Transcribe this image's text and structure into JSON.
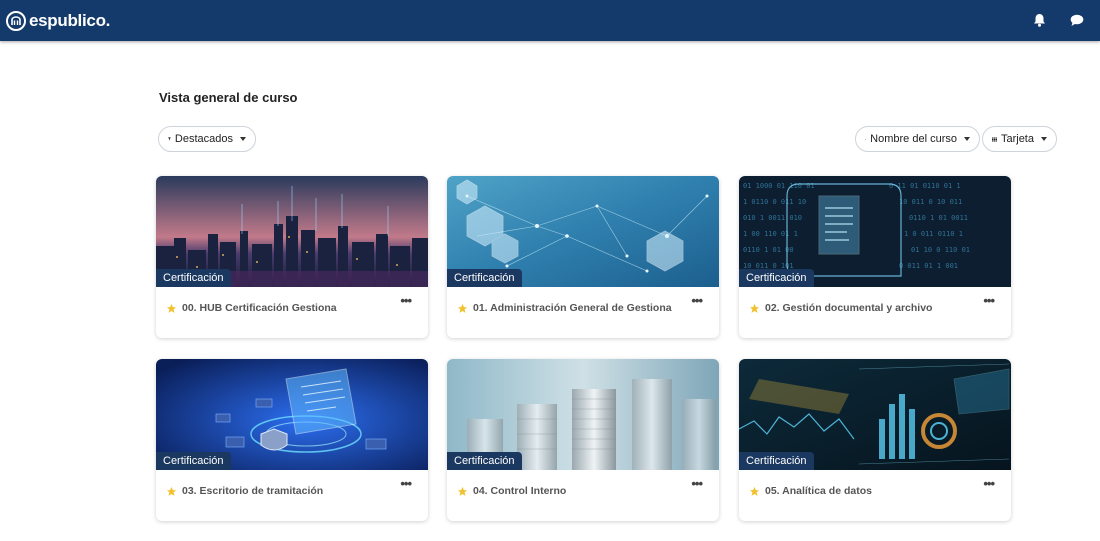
{
  "header": {
    "brand": "espublico.",
    "logo_icon": "espublico-logo-icon",
    "bell_icon": "bell-icon",
    "chat_icon": "chat-icon",
    "bg_color": "#143a6b"
  },
  "page": {
    "title": "Vista general de curso"
  },
  "toolbar": {
    "filter_label": "Destacados",
    "sort_label": "Nombre del curso",
    "view_label": "Tarjeta"
  },
  "courses": [
    {
      "category": "Certificación",
      "name": "00. HUB Certificación Gestiona"
    },
    {
      "category": "Certificación",
      "name": "01. Administración General de Gestiona"
    },
    {
      "category": "Certificación",
      "name": "02. Gestión documental y archivo"
    },
    {
      "category": "Certificación",
      "name": "03. Escritorio de tramitación"
    },
    {
      "category": "Certificación",
      "name": "04. Control Interno"
    },
    {
      "category": "Certificación",
      "name": "05. Analítica de datos"
    }
  ],
  "colors": {
    "star": "#f2c12e",
    "badge": "#1b3860"
  }
}
